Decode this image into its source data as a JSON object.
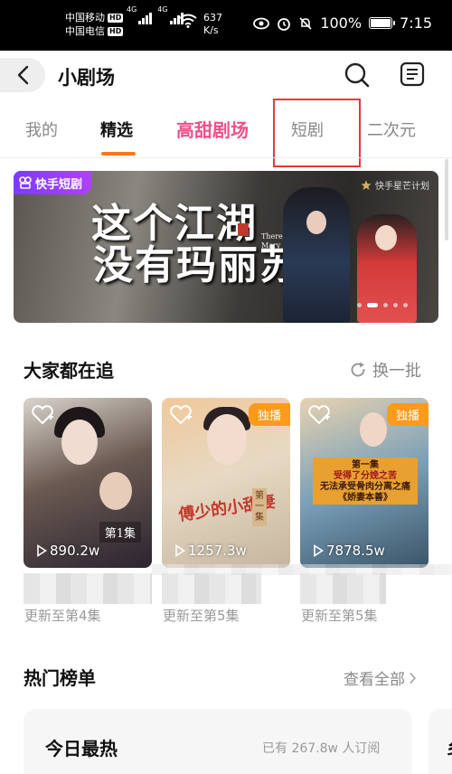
{
  "status_bar": {
    "carrier1": "中国移动",
    "carrier2": "中国电信",
    "hd_badge": "HD",
    "net_tag": "4G",
    "speed_value": "637",
    "speed_unit": "K/s",
    "battery": "100%",
    "time": "7:15"
  },
  "header": {
    "title": "小剧场"
  },
  "tabs": [
    {
      "label": "我的"
    },
    {
      "label": "精选"
    },
    {
      "label": "高甜剧场"
    },
    {
      "label": "短剧"
    },
    {
      "label": "二次元"
    }
  ],
  "banner": {
    "badge": "快手短剧",
    "partner": "快手星芒计划",
    "title_line1": "这个江湖",
    "title_line2": "没有玛丽苏",
    "subtitle_line1": "There is no",
    "subtitle_line2": "Mary Sue"
  },
  "trending": {
    "title": "大家都在追",
    "refresh_label": "换一批",
    "exclusive_label": "独播",
    "cards": [
      {
        "plays": "890.2w",
        "episode_badge": "第1集",
        "update": "更新至第4集"
      },
      {
        "plays": "1257.3w",
        "poster_text": "傅少的小甜妻",
        "episode_badge": "第一集",
        "update": "更新至第5集"
      },
      {
        "plays": "7878.5w",
        "poster_line1": "第一集",
        "poster_line2": "受得了分娩之苦",
        "poster_line3": "无法承受骨肉分离之痛",
        "poster_line4": "《娇妻本善》",
        "update": "更新至第5集"
      }
    ]
  },
  "hot_list": {
    "title": "热门榜单",
    "view_all": "查看全部",
    "card_title": "今日最热",
    "card_sub": "已有 267.8w 人订阅",
    "next_card_char": "乡"
  },
  "colors": {
    "accent_orange": "#ff7a1a",
    "pink": "#f0508a",
    "highlight_red": "#e83838"
  },
  "icons": [
    "back-icon",
    "search-icon",
    "menu-icon",
    "refresh-icon",
    "favorite-add-icon",
    "play-icon",
    "chevron-right-icon"
  ]
}
